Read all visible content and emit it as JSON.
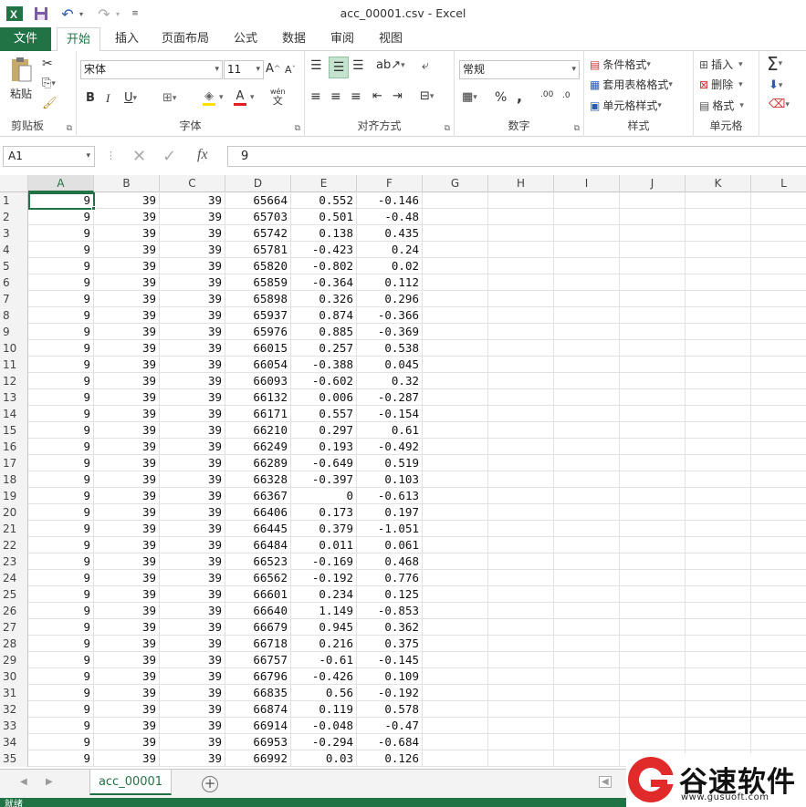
{
  "titlebar": {
    "title": "acc_00001.csv - Excel",
    "app_icon": "X",
    "save_icon": "save-icon",
    "undo_icon": "undo-icon",
    "redo_icon": "redo-icon"
  },
  "tabs": {
    "file": "文件",
    "items": [
      "开始",
      "插入",
      "页面布局",
      "公式",
      "数据",
      "审阅",
      "视图"
    ],
    "active": "开始"
  },
  "ribbon": {
    "clipboard": {
      "label": "剪贴板",
      "paste": "粘贴"
    },
    "font": {
      "label": "字体",
      "name": "宋体",
      "size": "11",
      "bold": "B",
      "italic": "I",
      "underline": "U",
      "font_color_glyph": "A",
      "wen": "wén",
      "wen_char": "文"
    },
    "alignment": {
      "label": "对齐方式"
    },
    "number": {
      "label": "数字",
      "format": "常规",
      "percent": "%",
      "comma": ",",
      "inc_decimal": ".00",
      "dec_decimal": ".0"
    },
    "styles": {
      "label": "样式",
      "conditional": "条件格式",
      "table": "套用表格格式",
      "cell_styles": "单元格样式"
    },
    "cells": {
      "label": "单元格",
      "insert": "插入",
      "delete": "删除",
      "format": "格式"
    },
    "editing": {
      "sum": "Σ"
    }
  },
  "formula_bar": {
    "name_box": "A1",
    "formula": "9",
    "fx": "fx"
  },
  "grid": {
    "columns": [
      "A",
      "B",
      "C",
      "D",
      "E",
      "F",
      "G",
      "H",
      "I",
      "J",
      "K",
      "L"
    ],
    "selected_cell": "A1",
    "rows": [
      [
        "1",
        "9",
        "39",
        "39",
        "65664",
        "0.552",
        "-0.146"
      ],
      [
        "2",
        "9",
        "39",
        "39",
        "65703",
        "0.501",
        "-0.48"
      ],
      [
        "3",
        "9",
        "39",
        "39",
        "65742",
        "0.138",
        "0.435"
      ],
      [
        "4",
        "9",
        "39",
        "39",
        "65781",
        "-0.423",
        "0.24"
      ],
      [
        "5",
        "9",
        "39",
        "39",
        "65820",
        "-0.802",
        "0.02"
      ],
      [
        "6",
        "9",
        "39",
        "39",
        "65859",
        "-0.364",
        "0.112"
      ],
      [
        "7",
        "9",
        "39",
        "39",
        "65898",
        "0.326",
        "0.296"
      ],
      [
        "8",
        "9",
        "39",
        "39",
        "65937",
        "0.874",
        "-0.366"
      ],
      [
        "9",
        "9",
        "39",
        "39",
        "65976",
        "0.885",
        "-0.369"
      ],
      [
        "10",
        "9",
        "39",
        "39",
        "66015",
        "0.257",
        "0.538"
      ],
      [
        "11",
        "9",
        "39",
        "39",
        "66054",
        "-0.388",
        "0.045"
      ],
      [
        "12",
        "9",
        "39",
        "39",
        "66093",
        "-0.602",
        "0.32"
      ],
      [
        "13",
        "9",
        "39",
        "39",
        "66132",
        "0.006",
        "-0.287"
      ],
      [
        "14",
        "9",
        "39",
        "39",
        "66171",
        "0.557",
        "-0.154"
      ],
      [
        "15",
        "9",
        "39",
        "39",
        "66210",
        "0.297",
        "0.61"
      ],
      [
        "16",
        "9",
        "39",
        "39",
        "66249",
        "0.193",
        "-0.492"
      ],
      [
        "17",
        "9",
        "39",
        "39",
        "66289",
        "-0.649",
        "0.519"
      ],
      [
        "18",
        "9",
        "39",
        "39",
        "66328",
        "-0.397",
        "0.103"
      ],
      [
        "19",
        "9",
        "39",
        "39",
        "66367",
        "0",
        "-0.613"
      ],
      [
        "20",
        "9",
        "39",
        "39",
        "66406",
        "0.173",
        "0.197"
      ],
      [
        "21",
        "9",
        "39",
        "39",
        "66445",
        "0.379",
        "-1.051"
      ],
      [
        "22",
        "9",
        "39",
        "39",
        "66484",
        "0.011",
        "0.061"
      ],
      [
        "23",
        "9",
        "39",
        "39",
        "66523",
        "-0.169",
        "0.468"
      ],
      [
        "24",
        "9",
        "39",
        "39",
        "66562",
        "-0.192",
        "0.776"
      ],
      [
        "25",
        "9",
        "39",
        "39",
        "66601",
        "0.234",
        "0.125"
      ],
      [
        "26",
        "9",
        "39",
        "39",
        "66640",
        "1.149",
        "-0.853"
      ],
      [
        "27",
        "9",
        "39",
        "39",
        "66679",
        "0.945",
        "0.362"
      ],
      [
        "28",
        "9",
        "39",
        "39",
        "66718",
        "0.216",
        "0.375"
      ],
      [
        "29",
        "9",
        "39",
        "39",
        "66757",
        "-0.61",
        "-0.145"
      ],
      [
        "30",
        "9",
        "39",
        "39",
        "66796",
        "-0.426",
        "0.109"
      ],
      [
        "31",
        "9",
        "39",
        "39",
        "66835",
        "0.56",
        "-0.192"
      ],
      [
        "32",
        "9",
        "39",
        "39",
        "66874",
        "0.119",
        "0.578"
      ],
      [
        "33",
        "9",
        "39",
        "39",
        "66914",
        "-0.048",
        "-0.47"
      ],
      [
        "34",
        "9",
        "39",
        "39",
        "66953",
        "-0.294",
        "-0.684"
      ],
      [
        "35",
        "9",
        "39",
        "39",
        "66992",
        "0.03",
        "0.126"
      ]
    ]
  },
  "sheets": {
    "active": "acc_00001",
    "add": "+"
  },
  "status": {
    "text": "就绪"
  },
  "watermark": {
    "brand": "谷速软件",
    "url": "www.gusuoft.com"
  },
  "colors": {
    "accent": "#217346",
    "watermark_red": "#e12b2b"
  }
}
